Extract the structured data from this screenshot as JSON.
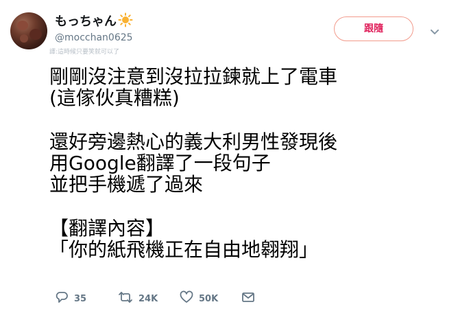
{
  "user": {
    "display_name": "もっちゃん",
    "handle": "@mocchan0625",
    "avatar_icon": "profile-avatar-icon",
    "emoji_icon": "sun-icon"
  },
  "watermark": "譯:這時候只要笑就可以了",
  "follow_label": "跟隨",
  "menu_icon": "chevron-down-icon",
  "tweet_lines": [
    "剛剛沒注意到沒拉拉鍊就上了電車",
    "(這傢伙真糟糕)",
    "",
    "還好旁邊熱心的義大利男性發現後",
    "用Google翻譯了一段句子",
    "並把手機遞了過來",
    "",
    "【翻譯內容】",
    "「你的紙飛機正在自由地翱翔」"
  ],
  "actions": {
    "reply": {
      "icon": "reply-icon",
      "count": "35"
    },
    "retweet": {
      "icon": "retweet-icon",
      "count": "24K"
    },
    "like": {
      "icon": "heart-icon",
      "count": "50K"
    },
    "dm": {
      "icon": "envelope-icon"
    }
  },
  "colors": {
    "follow_accent": "#e0245e",
    "muted": "#657786"
  }
}
